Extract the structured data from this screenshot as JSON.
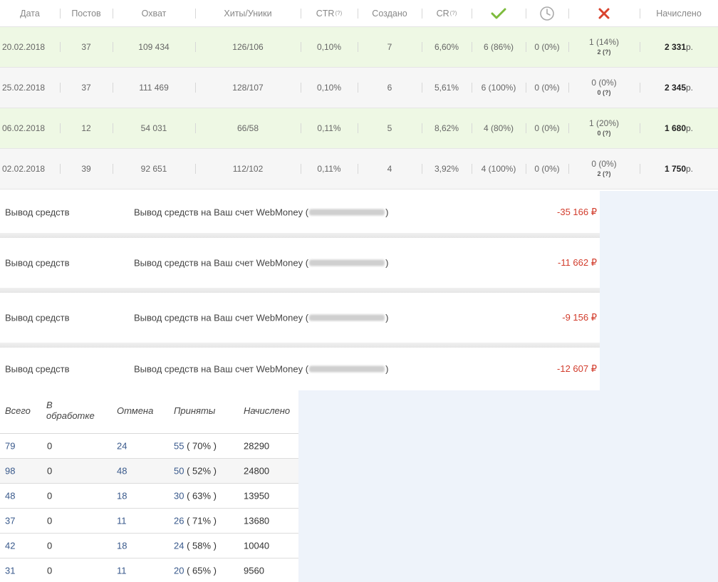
{
  "stats_table": {
    "headers": {
      "date": "Дата",
      "posts": "Постов",
      "reach": "Охват",
      "hits": "Хиты/Уники",
      "ctr": "CTR",
      "ctr_hint": "(?)",
      "created": "Создано",
      "cr": "CR",
      "cr_hint": "(?)",
      "accrued": "Начислено"
    },
    "header_icons": [
      "check-icon",
      "clock-icon",
      "cross-icon"
    ],
    "rows": [
      {
        "date": "20.02.2018",
        "posts": "37",
        "reach": "109 434",
        "hits": "126/106",
        "ctr": "0,10%",
        "created": "7",
        "cr": "6,60%",
        "approved": "6 (86%)",
        "pending": "0 (0%)",
        "rejected": "1 (14%)",
        "rejected_sub": "2 (?)",
        "accrued": "2 331",
        "currency": "р."
      },
      {
        "date": "25.02.2018",
        "posts": "37",
        "reach": "111 469",
        "hits": "128/107",
        "ctr": "0,10%",
        "created": "6",
        "cr": "5,61%",
        "approved": "6 (100%)",
        "pending": "0 (0%)",
        "rejected": "0 (0%)",
        "rejected_sub": "0 (?)",
        "accrued": "2 345",
        "currency": "р."
      },
      {
        "date": "06.02.2018",
        "posts": "12",
        "reach": "54 031",
        "hits": "66/58",
        "ctr": "0,11%",
        "created": "5",
        "cr": "8,62%",
        "approved": "4 (80%)",
        "pending": "0 (0%)",
        "rejected": "1 (20%)",
        "rejected_sub": "0 (?)",
        "accrued": "1 680",
        "currency": "р."
      },
      {
        "date": "02.02.2018",
        "posts": "39",
        "reach": "92 651",
        "hits": "112/102",
        "ctr": "0,11%",
        "created": "4",
        "cr": "3,92%",
        "approved": "4 (100%)",
        "pending": "0 (0%)",
        "rejected": "0 (0%)",
        "rejected_sub": "2 (?)",
        "accrued": "1 750",
        "currency": "р."
      }
    ]
  },
  "withdrawals": [
    {
      "label": "Вывод средств",
      "desc_prefix": "Вывод средств на Ваш счет WebMoney (",
      "desc_suffix": ")",
      "amount": "-35 166 ₽"
    },
    {
      "label": "Вывод средств",
      "desc_prefix": "Вывод средств на Ваш счет WebMoney (",
      "desc_suffix": ")",
      "amount": "-11 662 ₽"
    },
    {
      "label": "Вывод средств",
      "desc_prefix": "Вывод средств на Ваш счет WebMoney (",
      "desc_suffix": ")",
      "amount": "-9 156 ₽"
    },
    {
      "label": "Вывод средств",
      "desc_prefix": "Вывод средств на Ваш счет WebMoney (",
      "desc_suffix": ")",
      "amount": "-12 607 ₽"
    }
  ],
  "summary_table": {
    "headers": {
      "total": "Всего",
      "processing_1": "В",
      "processing_2": "обработке",
      "cancelled": "Отмена",
      "accepted": "Приняты",
      "accrued": "Начислено"
    },
    "rows": [
      {
        "total": "79",
        "processing": "0",
        "cancelled": "24",
        "accepted": "55",
        "accepted_pct": " ( 70% )",
        "accrued": "28290"
      },
      {
        "total": "98",
        "processing": "0",
        "cancelled": "48",
        "accepted": "50",
        "accepted_pct": " ( 52% )",
        "accrued": "24800"
      },
      {
        "total": "48",
        "processing": "0",
        "cancelled": "18",
        "accepted": "30",
        "accepted_pct": " ( 63% )",
        "accrued": "13950"
      },
      {
        "total": "37",
        "processing": "0",
        "cancelled": "11",
        "accepted": "26",
        "accepted_pct": " ( 71% )",
        "accrued": "13680"
      },
      {
        "total": "42",
        "processing": "0",
        "cancelled": "18",
        "accepted": "24",
        "accepted_pct": " ( 58% )",
        "accrued": "10040"
      },
      {
        "total": "31",
        "processing": "0",
        "cancelled": "11",
        "accepted": "20",
        "accepted_pct": " ( 65% )",
        "accrued": "9560"
      }
    ]
  },
  "colors": {
    "accent_green": "#7dbb3c",
    "reject_red": "#d9432e",
    "negative_amount": "#d23c2c",
    "link_blue": "#3a5a8c"
  }
}
